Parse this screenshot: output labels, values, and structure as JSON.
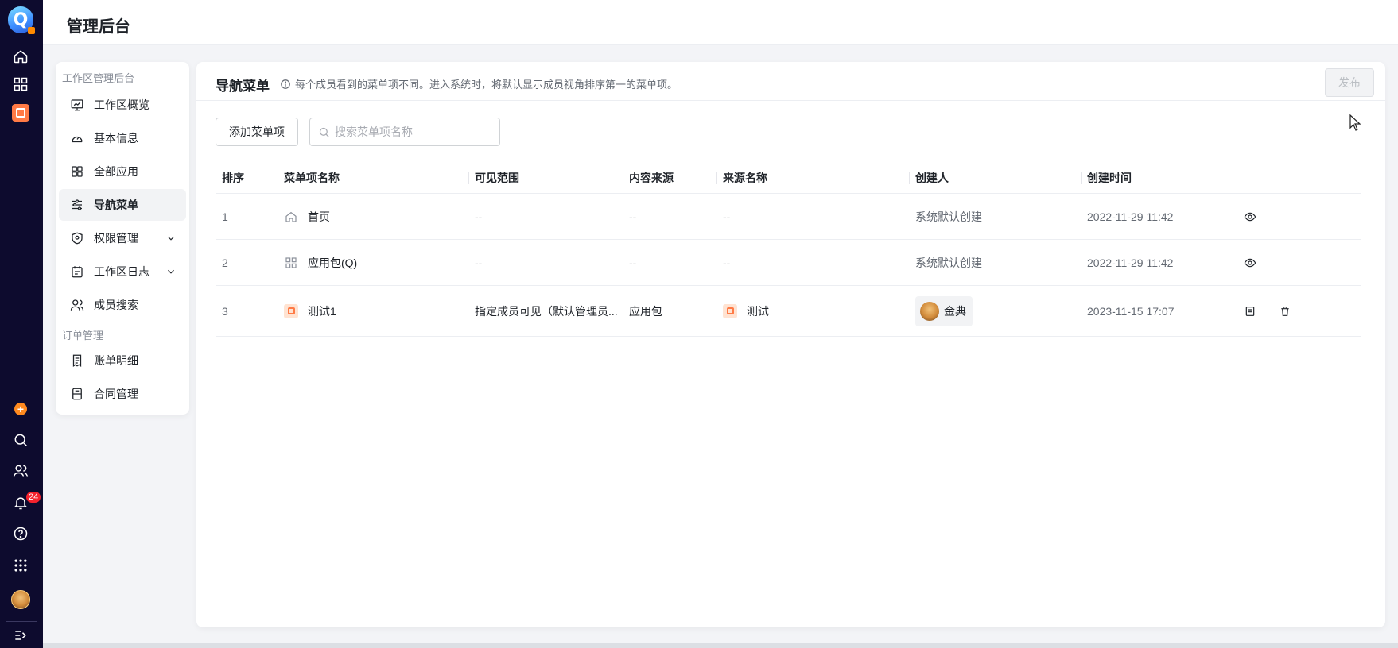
{
  "app": {
    "logo_letter": "Q",
    "title": "管理后台"
  },
  "rail": {
    "items": [
      "home-icon",
      "apps-grid-icon",
      "app-test-icon"
    ],
    "bottom_items": [
      "add-icon",
      "search-icon",
      "contacts-icon",
      "bell-icon",
      "help-icon",
      "launcher-icon",
      "avatar",
      "expand-icon"
    ],
    "notification_count": "24"
  },
  "sidebar": {
    "group1": "工作区管理后台",
    "group2": "订单管理",
    "items": [
      {
        "label": "工作区概览",
        "icon": "monitor-icon"
      },
      {
        "label": "基本信息",
        "icon": "dashboard-icon"
      },
      {
        "label": "全部应用",
        "icon": "grid-icon"
      },
      {
        "label": "导航菜单",
        "icon": "sliders-icon",
        "active": true
      },
      {
        "label": "权限管理",
        "icon": "shield-icon",
        "expandable": true
      },
      {
        "label": "工作区日志",
        "icon": "calendar-icon",
        "expandable": true
      },
      {
        "label": "成员搜索",
        "icon": "users-icon"
      },
      {
        "label": "账单明细",
        "icon": "receipt-icon"
      },
      {
        "label": "合同管理",
        "icon": "contract-icon"
      }
    ]
  },
  "main": {
    "title": "导航菜单",
    "hint": "每个成员看到的菜单项不同。进入系统时，将默认显示成员视角排序第一的菜单项。",
    "publish_label": "发布",
    "add_label": "添加菜单项",
    "search_placeholder": "搜索菜单项名称"
  },
  "table": {
    "columns": [
      "排序",
      "菜单项名称",
      "可见范围",
      "内容来源",
      "来源名称",
      "创建人",
      "创建时间",
      ""
    ],
    "rows": [
      {
        "order": "1",
        "icon": "home-icon",
        "name": "首页",
        "scope": "--",
        "source": "--",
        "source_name": "--",
        "creator": "系统默认创建",
        "created": "2022-11-29 11:42",
        "actions": [
          "view-icon"
        ]
      },
      {
        "order": "2",
        "icon": "apps-grid-icon",
        "name": "应用包(Q)",
        "scope": "--",
        "source": "--",
        "source_name": "--",
        "creator": "系统默认创建",
        "created": "2022-11-29 11:42",
        "actions": [
          "view-icon"
        ]
      },
      {
        "order": "3",
        "icon": "app-test-icon",
        "name": "测试1",
        "scope": "指定成员可见（默认管理员...",
        "source": "应用包",
        "source_name": "测试",
        "creator": "金典",
        "created": "2023-11-15 17:07",
        "actions": [
          "edit-icon",
          "delete-icon"
        ]
      }
    ]
  },
  "colors": {
    "rail_bg": "#0d0b2e",
    "accent_orange": "#ff7a45",
    "badge_red": "#f5222d"
  }
}
